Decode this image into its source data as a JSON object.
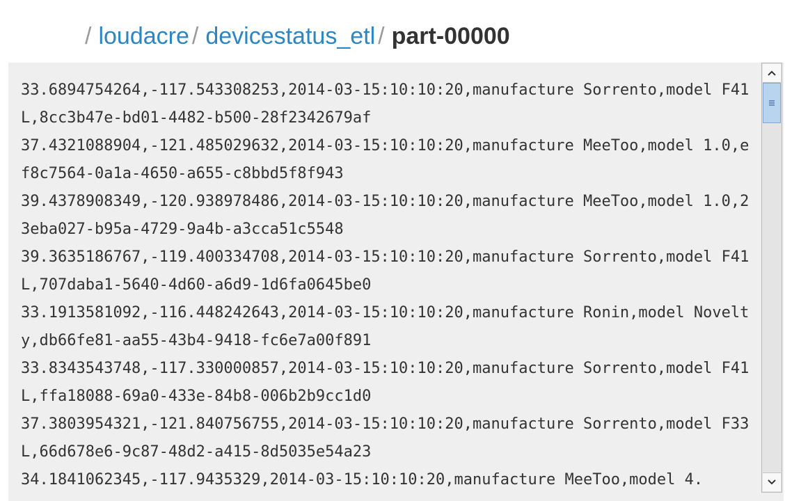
{
  "breadcrumb": {
    "separator": "/",
    "items": [
      {
        "label": "loudacre"
      },
      {
        "label": "devicestatus_etl"
      }
    ],
    "current": "part-00000"
  },
  "file_content": "33.6894754264,-117.543308253,2014-03-15:10:10:20,manufacture Sorrento,model F41L,8cc3b47e-bd01-4482-b500-28f2342679af\n37.4321088904,-121.485029632,2014-03-15:10:10:20,manufacture MeeToo,model 1.0,ef8c7564-0a1a-4650-a655-c8bbd5f8f943\n39.4378908349,-120.938978486,2014-03-15:10:10:20,manufacture MeeToo,model 1.0,23eba027-b95a-4729-9a4b-a3cca51c5548\n39.3635186767,-119.400334708,2014-03-15:10:10:20,manufacture Sorrento,model F41L,707daba1-5640-4d60-a6d9-1d6fa0645be0\n33.1913581092,-116.448242643,2014-03-15:10:10:20,manufacture Ronin,model Novelty,db66fe81-aa55-43b4-9418-fc6e7a00f891\n33.8343543748,-117.330000857,2014-03-15:10:10:20,manufacture Sorrento,model F41L,ffa18088-69a0-433e-84b8-006b2b9cc1d0\n37.3803954321,-121.840756755,2014-03-15:10:10:20,manufacture Sorrento,model F33L,66d678e6-9c87-48d2-a415-8d5035e54a23\n34.1841062345,-117.9435329,2014-03-15:10:10:20,manufacture MeeToo,model 4.",
  "scrollbar": {
    "up_icon": "chevron-up-icon",
    "down_icon": "chevron-down-icon",
    "thumb_icon": "grip-icon"
  },
  "colors": {
    "link": "#2a86c4",
    "current": "#333333",
    "separator": "#9a9a9a",
    "viewer_bg": "#efefef",
    "scroll_thumb": "#b8d4ee"
  }
}
